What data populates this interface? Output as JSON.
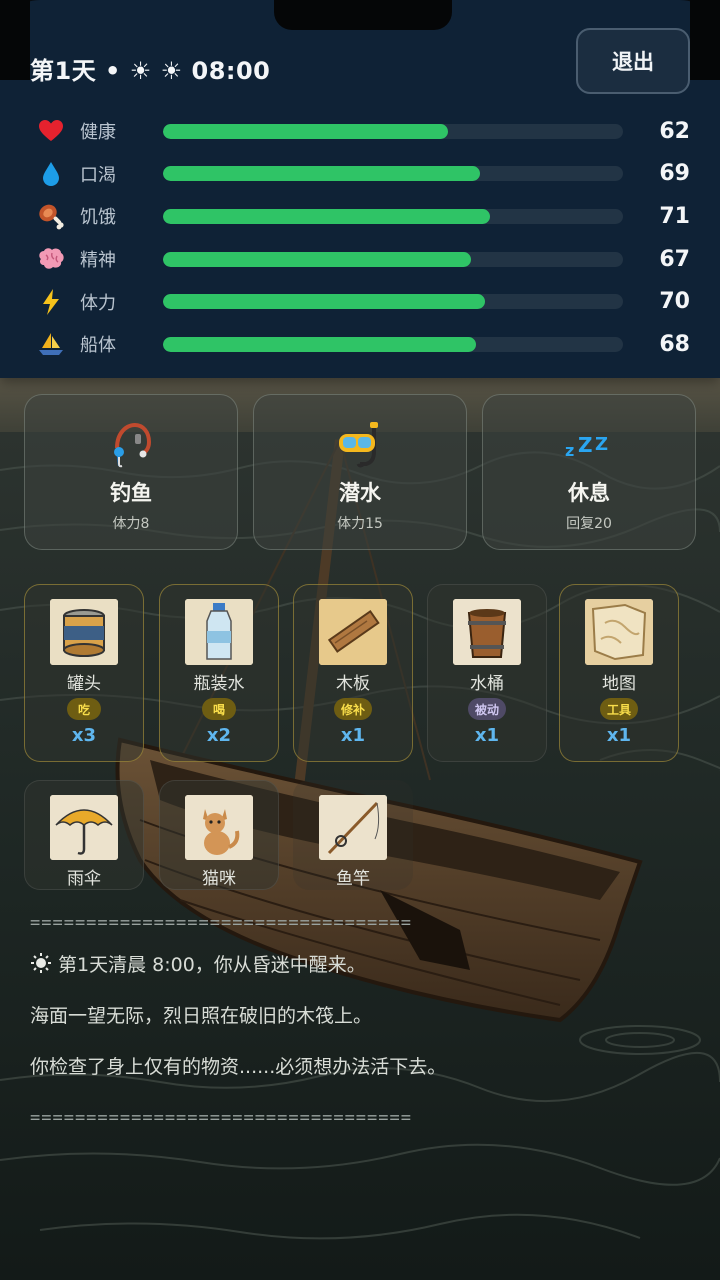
{
  "header": {
    "day_title": "第1天 • ☀ ☀ 08:00",
    "exit_label": "退出"
  },
  "stats": [
    {
      "icon": "heart-icon",
      "label": "健康",
      "value": 62
    },
    {
      "icon": "water-drop-icon",
      "label": "口渴",
      "value": 69
    },
    {
      "icon": "meat-icon",
      "label": "饥饿",
      "value": 71
    },
    {
      "icon": "brain-icon",
      "label": "精神",
      "value": 67
    },
    {
      "icon": "lightning-icon",
      "label": "体力",
      "value": 70
    },
    {
      "icon": "boat-icon",
      "label": "船体",
      "value": 68
    }
  ],
  "actions": [
    {
      "icon": "fishing-icon",
      "title": "钓鱼",
      "sub": "体力8"
    },
    {
      "icon": "diving-mask-icon",
      "title": "潜水",
      "sub": "体力15"
    },
    {
      "icon": "sleep-icon",
      "title": "休息",
      "sub": "回复20"
    }
  ],
  "inventory": [
    {
      "icon": "canned-food-icon",
      "name": "罐头",
      "tag": "吃",
      "tag_style": "gold",
      "qty": "x3"
    },
    {
      "icon": "water-bottle-icon",
      "name": "瓶装水",
      "tag": "喝",
      "tag_style": "gold",
      "qty": "x2"
    },
    {
      "icon": "wood-plank-icon",
      "name": "木板",
      "tag": "修补",
      "tag_style": "gold",
      "qty": "x1"
    },
    {
      "icon": "bucket-icon",
      "name": "水桶",
      "tag": "被动",
      "tag_style": "purple",
      "qty": "x1"
    },
    {
      "icon": "map-icon",
      "name": "地图",
      "tag": "工具",
      "tag_style": "gold",
      "qty": "x1"
    },
    {
      "icon": "umbrella-icon",
      "name": "雨伞"
    },
    {
      "icon": "cat-icon",
      "name": "猫咪"
    },
    {
      "icon": "fishing-rod-icon",
      "name": "鱼竿"
    }
  ],
  "log": {
    "separator": "==================================",
    "lines": [
      "第1天清晨 8:00，你从昏迷中醒来。",
      "海面一望无际，烈日照在破旧的木筏上。",
      "你检查了身上仅有的物资......必须想办法活下去。"
    ]
  },
  "colors": {
    "panel": "#0f2236",
    "bar_fill": "#2fc466",
    "bar_track": "#223445",
    "qty": "#5fb6ee",
    "tag_gold": "#f8dd4a"
  }
}
